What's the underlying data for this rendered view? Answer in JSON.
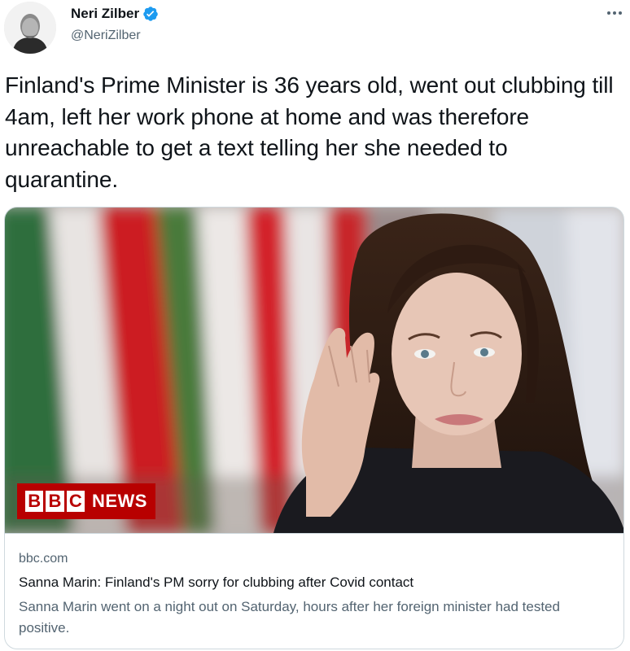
{
  "author": {
    "display_name": "Neri Zilber",
    "handle": "@NeriZilber",
    "verified": true
  },
  "tweet": {
    "text": "Finland's Prime Minister is 36 years old, went out clubbing till 4am, left her work phone at home and was therefore unreachable to get a text telling her she needed to quarantine."
  },
  "card": {
    "domain": "bbc.com",
    "title": "Sanna Marin: Finland's PM sorry for clubbing after Covid contact",
    "description": "Sanna Marin went on a night out on Saturday, hours after her foreign minister had tested positive.",
    "logo": {
      "letters": [
        "B",
        "B",
        "C"
      ],
      "text": "NEWS"
    }
  },
  "icons": {
    "verified": "verified-badge-icon",
    "more": "more-options-icon"
  },
  "colors": {
    "verified_blue": "#1d9bf0",
    "bbc_red": "#b80000",
    "secondary_text": "#536471",
    "primary_text": "#0f1419",
    "border": "#cfd9de"
  }
}
